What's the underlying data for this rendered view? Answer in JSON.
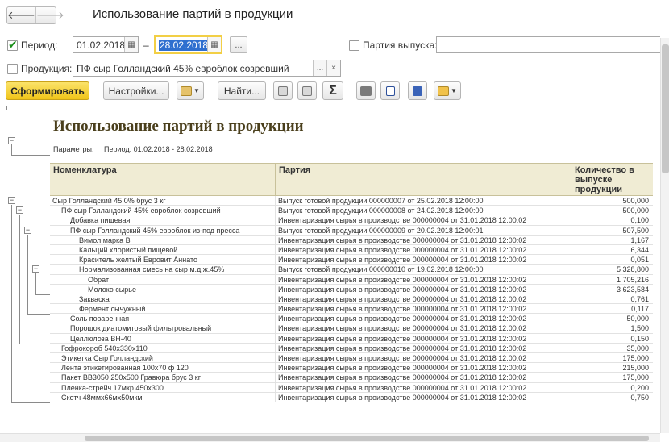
{
  "window": {
    "title": "Использование партий в продукции",
    "nav_back": "🡐",
    "nav_forward": "🡒"
  },
  "filters": {
    "period_label": "Период:",
    "period_checked": true,
    "date_from": "01.02.2018",
    "date_dash": "–",
    "date_to": "28.02.2018",
    "select_btn": "...",
    "batch_label": "Партия выпуска:",
    "batch_checked": false,
    "product_label": "Продукция:",
    "product_checked": false,
    "product_value": "ПФ сыр Голландский 45% евроблок созревший",
    "clear_btn": "×",
    "calendar_icon": "calendar-icon"
  },
  "toolbar": {
    "generate": "Сформировать",
    "settings": "Настройки...",
    "find": "Найти...",
    "sum": "Σ"
  },
  "report": {
    "title": "Использование партий в продукции",
    "params_label": "Параметры:",
    "params_value": "Период: 01.02.2018 - 28.02.2018",
    "columns": [
      "Номенклатура",
      "Партия",
      "Количество в выпуске продукции"
    ],
    "rows": [
      {
        "level": 0,
        "name": "Сыр Голландский 45,0% брус 3 кг",
        "batch": "Выпуск готовой продукции 000000007 от 25.02.2018 12:00:00",
        "qty": "500,000"
      },
      {
        "level": 1,
        "name": "ПФ сыр Голландский 45% евроблок созревший",
        "batch": "Выпуск готовой продукции 000000008 от 24.02.2018 12:00:00",
        "qty": "500,000"
      },
      {
        "level": 2,
        "name": "Добавка пищевая",
        "batch": "Инвентаризация сырья в производстве 000000004 от 31.01.2018 12:00:02",
        "qty": "0,100"
      },
      {
        "level": 2,
        "name": "ПФ сыр Голландский 45% евроблок из-под пресса",
        "batch": "Выпуск готовой продукции 000000009 от 20.02.2018 12:00:01",
        "qty": "507,500"
      },
      {
        "level": 3,
        "name": "Вимол марка В",
        "batch": "Инвентаризация сырья в производстве 000000004 от 31.01.2018 12:00:02",
        "qty": "1,167"
      },
      {
        "level": 3,
        "name": "Кальций хлористый пищевой",
        "batch": "Инвентаризация сырья в производстве 000000004 от 31.01.2018 12:00:02",
        "qty": "6,344"
      },
      {
        "level": 3,
        "name": "Краситель желтый Евровит Аннато",
        "batch": "Инвентаризация сырья в производстве 000000004 от 31.01.2018 12:00:02",
        "qty": "0,051"
      },
      {
        "level": 3,
        "name": "Нормализованная смесь на сыр м.д.ж.45%",
        "batch": "Выпуск готовой продукции 000000010 от 19.02.2018 12:00:00",
        "qty": "5 328,800"
      },
      {
        "level": 4,
        "name": "Обрат",
        "batch": "Инвентаризация сырья в производстве 000000004 от 31.01.2018 12:00:02",
        "qty": "1 705,216"
      },
      {
        "level": 4,
        "name": "Молоко сырье",
        "batch": "Инвентаризация сырья в производстве 000000004 от 31.01.2018 12:00:02",
        "qty": "3 623,584"
      },
      {
        "level": 3,
        "name": "Закваска",
        "batch": "Инвентаризация сырья в производстве 000000004 от 31.01.2018 12:00:02",
        "qty": "0,761"
      },
      {
        "level": 3,
        "name": "Фермент сычужный",
        "batch": "Инвентаризация сырья в производстве 000000004 от 31.01.2018 12:00:02",
        "qty": "0,117"
      },
      {
        "level": 2,
        "name": "Соль поваренная",
        "batch": "Инвентаризация сырья в производстве 000000004 от 31.01.2018 12:00:02",
        "qty": "50,000"
      },
      {
        "level": 2,
        "name": "Порошок диатомитовый фильтровальный",
        "batch": "Инвентаризация сырья в производстве 000000004 от 31.01.2018 12:00:02",
        "qty": "1,500"
      },
      {
        "level": 2,
        "name": "Целлюлоза ВН-40",
        "batch": "Инвентаризация сырья в производстве 000000004 от 31.01.2018 12:00:02",
        "qty": "0,150"
      },
      {
        "level": 1,
        "name": "Гофрокороб 540х330х110",
        "batch": "Инвентаризация сырья в производстве 000000004 от 31.01.2018 12:00:02",
        "qty": "35,000"
      },
      {
        "level": 1,
        "name": "Этикетка Сыр Голландский",
        "batch": "Инвентаризация сырья в производстве 000000004 от 31.01.2018 12:00:02",
        "qty": "175,000"
      },
      {
        "level": 1,
        "name": "Лента этикетированная 100х70 ф 120",
        "batch": "Инвентаризация сырья в производстве 000000004 от 31.01.2018 12:00:02",
        "qty": "215,000"
      },
      {
        "level": 1,
        "name": "Пакет BB3050 250х500 Гравюра брус 3 кг",
        "batch": "Инвентаризация сырья в производстве 000000004 от 31.01.2018 12:00:02",
        "qty": "175,000"
      },
      {
        "level": 1,
        "name": "Пленка-стрейч 17мкр 450х300",
        "batch": "Инвентаризация сырья в производстве 000000004 от 31.01.2018 12:00:02",
        "qty": "0,200"
      },
      {
        "level": 1,
        "name": "Скотч 48ммх66мх50мкм",
        "batch": "Инвентаризация сырья в производстве 000000004 от 31.01.2018 12:00:02",
        "qty": "0,750"
      }
    ]
  },
  "colors": {
    "header_bg": "#f0ecd4",
    "primary_button": "#f0c419",
    "title_color": "#4a3f1c"
  }
}
